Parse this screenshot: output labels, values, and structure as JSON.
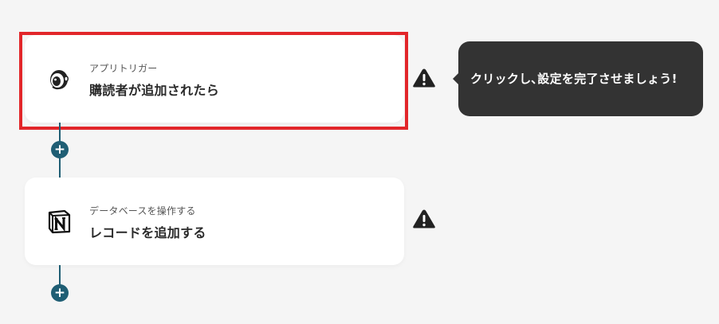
{
  "flow": {
    "steps": [
      {
        "subtitle": "アプリトリガー",
        "title": "購読者が追加されたら",
        "icon": "mailchimp-icon",
        "highlighted": true,
        "warning": true
      },
      {
        "subtitle": "データベースを操作する",
        "title": "レコードを追加する",
        "icon": "notion-icon",
        "highlighted": false,
        "warning": true
      }
    ],
    "add_button_label": "+"
  },
  "tooltip": {
    "text": "クリックし､設定を完了させましょう!"
  },
  "colors": {
    "background": "#f5f5f5",
    "card": "#ffffff",
    "accent": "#1f5e74",
    "highlight_border": "#e2262a",
    "tooltip_bg": "#333333",
    "warning": "#222222"
  }
}
